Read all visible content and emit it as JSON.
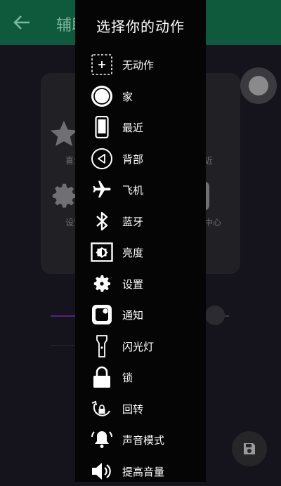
{
  "app": {
    "title": "辅助",
    "back_icon": "arrow-left-icon"
  },
  "background_panel": {
    "items": [
      {
        "label": "喜爱",
        "icon": "star-icon"
      },
      {
        "label": "最近",
        "icon": "phone-icon"
      },
      {
        "label": "设置",
        "icon": "gear-icon"
      },
      {
        "label": "控制中心",
        "icon": "toggle-icon"
      }
    ]
  },
  "dialog": {
    "title": "选择你的动作",
    "items": [
      {
        "label": "无动作",
        "icon": "dashed-plus-icon"
      },
      {
        "label": "家",
        "icon": "home-circle-icon"
      },
      {
        "label": "最近",
        "icon": "phone-icon"
      },
      {
        "label": "背部",
        "icon": "back-triangle-icon"
      },
      {
        "label": "飞机",
        "icon": "airplane-icon"
      },
      {
        "label": "蓝牙",
        "icon": "bluetooth-icon"
      },
      {
        "label": "亮度",
        "icon": "brightness-icon"
      },
      {
        "label": "设置",
        "icon": "gear-icon"
      },
      {
        "label": "通知",
        "icon": "notification-icon"
      },
      {
        "label": "闪光灯",
        "icon": "flashlight-icon"
      },
      {
        "label": "锁",
        "icon": "lock-icon"
      },
      {
        "label": "回转",
        "icon": "rotate-lock-icon"
      },
      {
        "label": "声音模式",
        "icon": "bell-icon"
      },
      {
        "label": "提高音量",
        "icon": "volume-up-icon"
      }
    ]
  },
  "colors": {
    "app_bar": "#0f5a3c",
    "dialog_bg": "#050505",
    "screen_bg": "#15131c"
  }
}
